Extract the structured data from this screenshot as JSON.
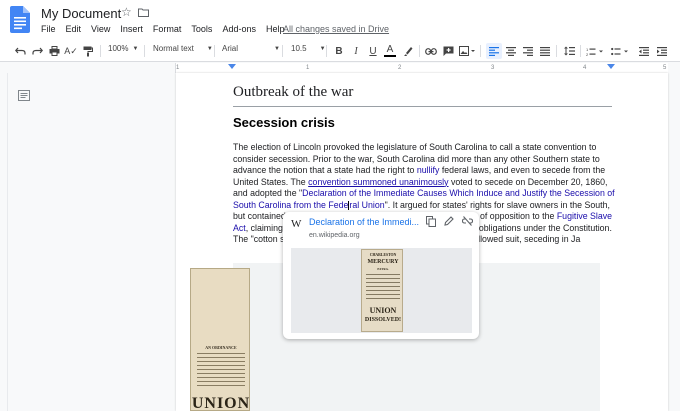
{
  "title_bar": {
    "doc_title": "My Document",
    "save_status": "All changes saved in Drive"
  },
  "menu": {
    "items": [
      "File",
      "Edit",
      "View",
      "Insert",
      "Format",
      "Tools",
      "Add-ons",
      "Help"
    ]
  },
  "toolbar": {
    "zoom": "100%",
    "style": "Normal text",
    "font": "Arial",
    "font_size": "10.5",
    "bold": "B",
    "italic": "I",
    "underline": "U",
    "text_color": "A"
  },
  "ruler": {
    "ticks": [
      "1",
      "1",
      "2",
      "3",
      "4",
      "5"
    ]
  },
  "document": {
    "heading1": "Outbreak of the war",
    "heading2": "Secession crisis",
    "p1_a": "The election of Lincoln provoked the legislature of South Carolina to call a state convention to consider secession. Prior to the war, South Carolina did more than any other Southern state to advance the notion that a state had the right to ",
    "p1_link1": "nullify",
    "p1_b": " federal laws, and even to secede from the United States. The ",
    "p1_link2": "convention summoned unanimously",
    "p1_c": " voted to secede on December 20, 1860, and adopted the \"",
    "p1_link3a": "Declaration of the Immediate Causes Which Induce and Justify the Secession of South Carolina from the Fede",
    "p1_link3b": "ral Union",
    "p1_d": "\". It argued for states' rights for slave owners in the South, but contained a c",
    "p1_e": "of opposition to the ",
    "p1_link4": "Fugitive Slave Act",
    "p1_f": ", claiming",
    "p1_g": "obligations under the Constitution. The \"cotton s",
    "p1_h": "isiana, and Texas followed suit, seceding in Ja"
  },
  "link_popup": {
    "source_icon": "W",
    "link_title": "Declaration of the Immedi...",
    "url": "en.wikipedia.org",
    "thumb_texts": [
      "CHARLESTON",
      "MERCURY",
      "EXTRA.",
      "UNION",
      "DISSOLVED!"
    ]
  },
  "newspaper": {
    "heading": "AN ORDINANCE",
    "big": "UNION"
  }
}
